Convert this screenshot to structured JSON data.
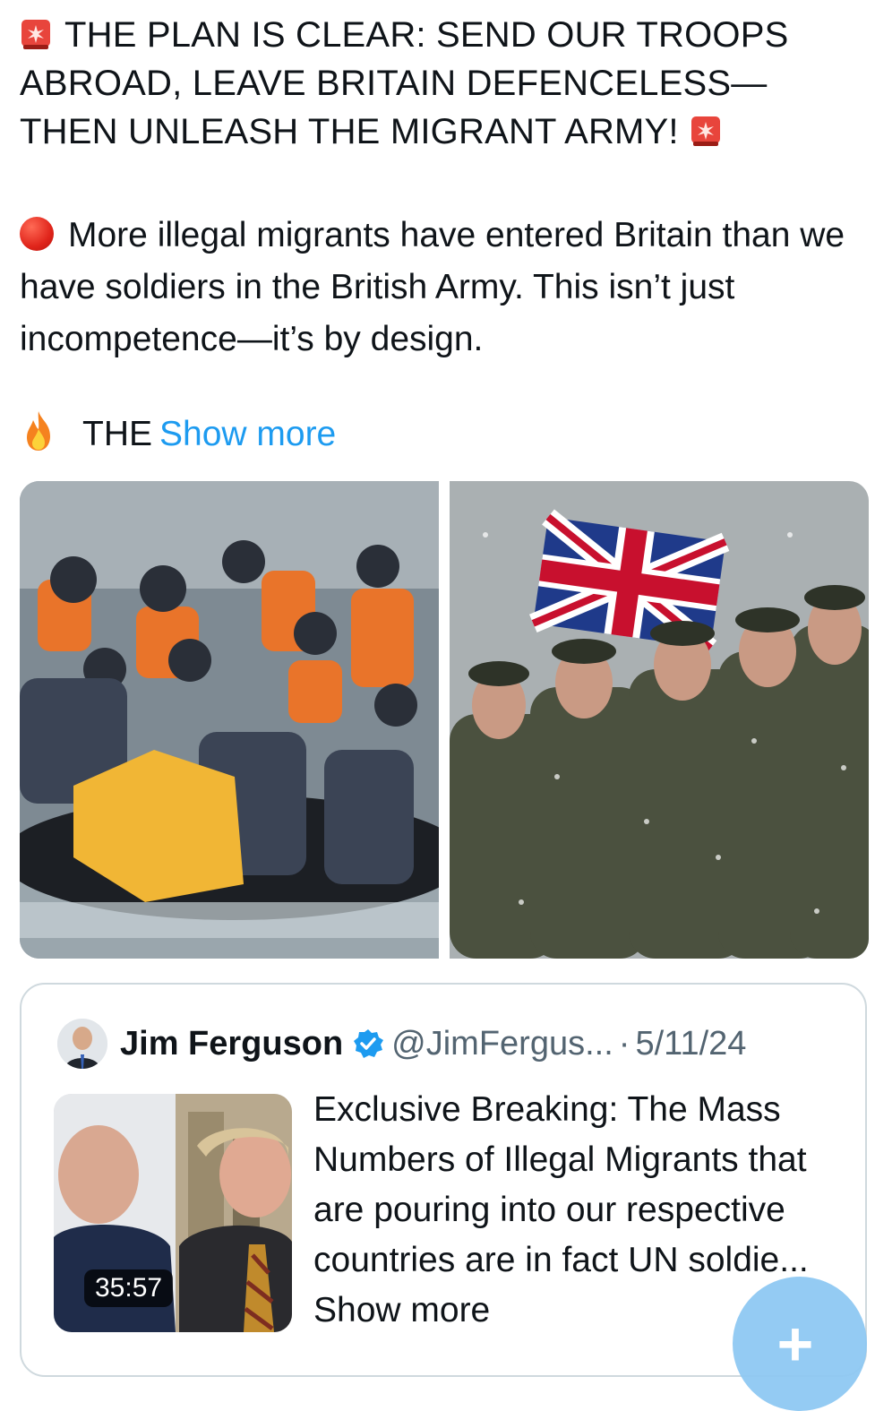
{
  "post": {
    "headline": "THE PLAN IS CLEAR: SEND OUR TROOPS ABROAD, LEAVE BRITAIN DEFENCELESS—THEN UNLEASH THE MIGRANT ARMY!",
    "body": "More illegal migrants have entered Britain than we have soldiers in the British Army. This isn’t just incompetence—it’s by design.",
    "teaser": "THE",
    "show_more": "Show more"
  },
  "quoted": {
    "name": "Jim Ferguson",
    "handle": "@JimFergus...",
    "separator": "·",
    "date": "5/11/24",
    "text": "Exclusive Breaking: The Mass Numbers of Illegal Migrants that are pouring into our respective countries are in fact UN soldie...",
    "show_more": "Show more",
    "video_duration": "35:57"
  },
  "fab": {
    "label": "+"
  },
  "icons": [
    "siren-icon",
    "red-circle-icon",
    "fire-icon",
    "verified-badge-icon",
    "compose-plus-icon"
  ]
}
